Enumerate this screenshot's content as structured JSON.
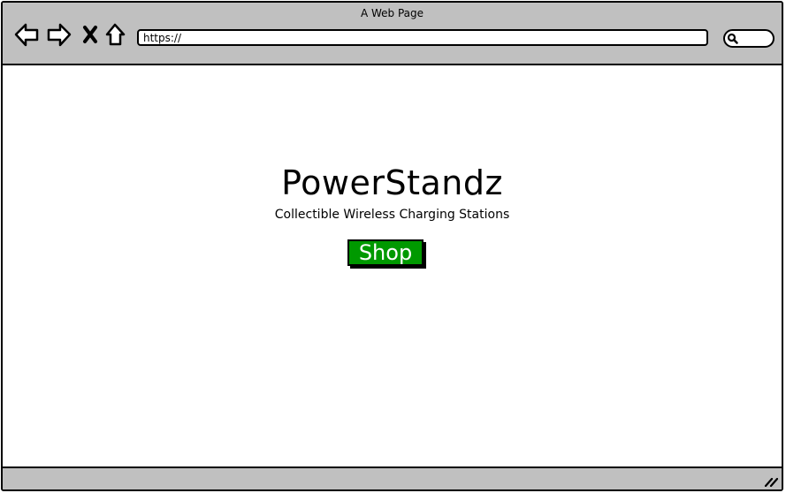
{
  "browser": {
    "title": "A Web Page",
    "url_value": "https://",
    "icons": {
      "back": "back-arrow-icon",
      "forward": "forward-arrow-icon",
      "stop": "close-icon",
      "home": "home-icon",
      "search": "search-icon",
      "resize": "resize-grip-icon"
    },
    "colors": {
      "chrome": "#c0c0c0",
      "border": "#000000"
    }
  },
  "page": {
    "brand": "PowerStandz",
    "tagline": "Collectible Wireless Charging Stations",
    "shop_label": "Shop",
    "colors": {
      "shop_button": "#009900",
      "shop_text": "#ffffff"
    }
  }
}
